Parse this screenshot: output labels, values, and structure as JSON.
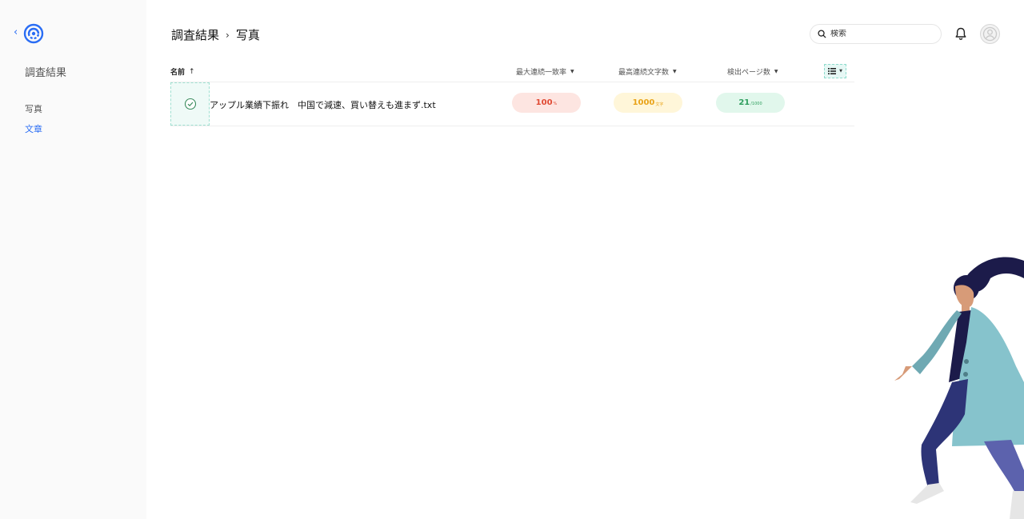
{
  "sidebar": {
    "title": "調査結果",
    "items": [
      {
        "label": "写真",
        "active": false
      },
      {
        "label": "文章",
        "active": true
      }
    ]
  },
  "header": {
    "breadcrumb": [
      "調査結果",
      "写真"
    ],
    "search_placeholder": "検索"
  },
  "table": {
    "columns": {
      "name": "名前",
      "max_consecutive_match": "最大連続一致率",
      "max_consecutive_chars": "最高連続文字数",
      "detected_pages": "検出ページ数"
    },
    "rows": [
      {
        "name": "アップル業績下振れ　中国で減速、買い替えも進まず.txt",
        "match_value": "100",
        "match_unit": "%",
        "chars_value": "1000",
        "chars_unit": "文字",
        "pages_value": "21",
        "pages_unit": "/1000"
      }
    ]
  },
  "colors": {
    "accent": "#2a6df4",
    "red_pill": "#fde5e1",
    "yellow_pill": "#fff6d9",
    "green_pill": "#e1f7ec"
  }
}
